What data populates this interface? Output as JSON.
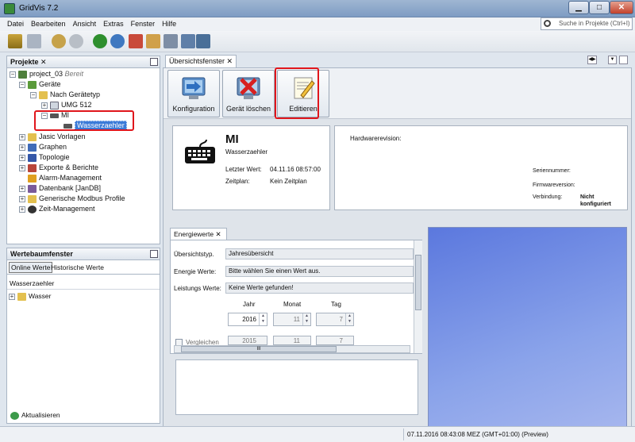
{
  "window": {
    "title": "GridVis 7.2"
  },
  "menu": [
    "Datei",
    "Bearbeiten",
    "Ansicht",
    "Extras",
    "Fenster",
    "Hilfe"
  ],
  "search": {
    "placeholder": "Suche in Projekte (Ctrl+I)"
  },
  "projects_panel": {
    "title": "Projekte",
    "project_name": "project_03",
    "project_status": "Bereit",
    "tree": {
      "geraete": "Geräte",
      "nach_geraetetyp": "Nach Gerätetyp",
      "umg512": "UMG 512",
      "mi": "MI",
      "wasserzaehler": "Wasserzaehler",
      "jasic": "Jasic Vorlagen",
      "graphen": "Graphen",
      "topologie": "Topologie",
      "exporte": "Exporte & Berichte",
      "alarm": "Alarm-Management",
      "datenbank": "Datenbank [JanDB]",
      "modbus": "Generische Modbus Profile",
      "zeit": "Zeit-Management"
    }
  },
  "wertebaum_panel": {
    "title": "Wertebaumfenster",
    "tab_online": "Online Werte",
    "tab_historic": "Historische Werte",
    "device": "Wasserzaehler",
    "item": "Wasser",
    "refresh": "Aktualisieren"
  },
  "editor": {
    "tab": "Übersichtsfenster",
    "buttons": {
      "config": "Konfiguration",
      "delete": "Gerät löschen",
      "edit": "Editieren"
    },
    "device_card": {
      "name": "MI",
      "subtitle": "Wasserzaehler",
      "last_value_label": "Letzter Wert:",
      "last_value": "04.11.16 08:57:00",
      "schedule_label": "Zeitplan:",
      "schedule": "Kein Zeitplan"
    },
    "hw_card": {
      "hw_revision": "Hardwarerevision:",
      "serial": "Seriennummer:",
      "firmware": "Firmwareversion:",
      "connection_label": "Verbindung:",
      "connection_value_1": "Nicht",
      "connection_value_2": "konfiguriert"
    },
    "energy": {
      "tab": "Energiewerte",
      "overview_label": "Übersichtstyp.",
      "overview_value": "Jahresübersicht",
      "energy_label": "Energie Werte:",
      "energy_value": "Bitte wählen Sie einen Wert aus.",
      "power_label": "Leistungs Werte:",
      "power_value": "Keine Werte gefunden!",
      "col_year": "Jahr",
      "col_month": "Monat",
      "col_day": "Tag",
      "year": "2016",
      "month": "11",
      "day": "7",
      "compare_label": "Vergleichen",
      "compare_year": "2015",
      "compare_month": "11",
      "compare_day": "7"
    }
  },
  "statusbar": {
    "text": "07.11.2016 08:43:08 MEZ (GMT+01:00)  (Preview)"
  },
  "colors": {
    "accent_red": "#e0161c",
    "selection": "#3b7bd8",
    "chart_blue": "#7d95e6"
  }
}
